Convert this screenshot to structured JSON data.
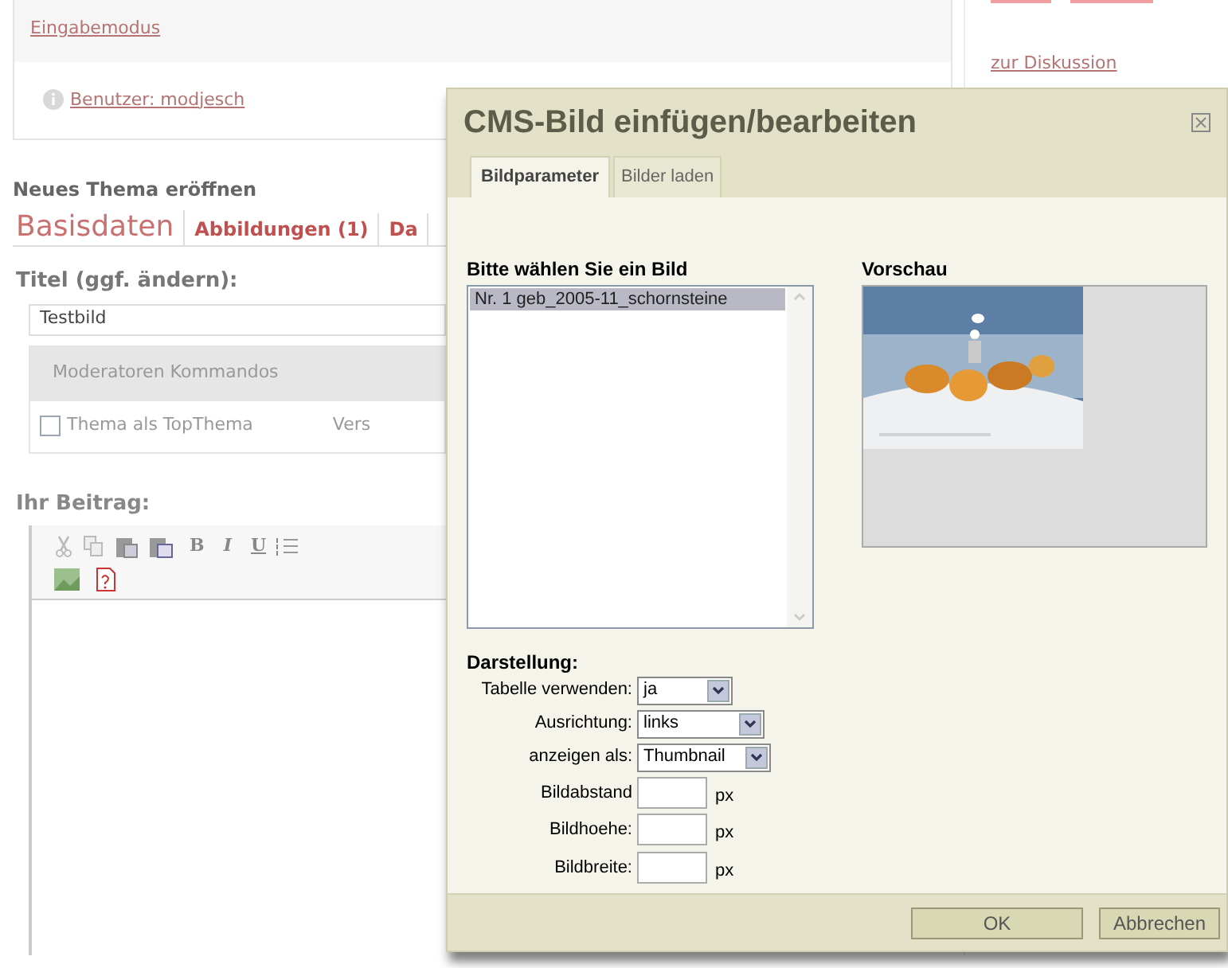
{
  "top_box": {
    "mode_link": "Eingabemodus",
    "user_link": "Benutzer: modjesch"
  },
  "sidebar": {
    "link": "zur Diskussion"
  },
  "form": {
    "heading": "Neues Thema eröffnen",
    "tabs": [
      {
        "label": "Basisdaten",
        "selected": true
      },
      {
        "label": "Abbildungen (1)",
        "selected": false
      },
      {
        "label": "Da",
        "selected": false
      }
    ],
    "title_label": "Titel (ggf. ändern):",
    "title_value": "Testbild",
    "moderator_heading": "Moderatoren Kommandos",
    "top_topic": {
      "label": "Thema als TopThema",
      "checked": false
    },
    "cut_text": "Vers",
    "post_label": "Ihr Beitrag:",
    "format_buttons": [
      "B",
      "I",
      "U"
    ]
  },
  "dialog": {
    "title": "CMS-Bild einfügen/bearbeiten",
    "tabs": [
      {
        "label": "Bildparameter",
        "selected": true
      },
      {
        "label": "Bilder laden",
        "selected": false
      }
    ],
    "list_label": "Bitte wählen Sie ein Bild",
    "images": [
      {
        "label": "Nr. 1 geb_2005-11_schornsteine",
        "selected": true
      }
    ],
    "preview_label": "Vorschau",
    "display_label": "Darstellung:",
    "fields": [
      {
        "kind": "select",
        "label": "Tabelle verwenden:",
        "value": "ja"
      },
      {
        "kind": "select",
        "label": "Ausrichtung:",
        "value": "links"
      },
      {
        "kind": "select",
        "label": "anzeigen als:",
        "value": "Thumbnail"
      },
      {
        "kind": "number",
        "label": "Bildabstand",
        "unit": "px"
      },
      {
        "kind": "number",
        "label": "Bildhoehe:",
        "unit": "px"
      },
      {
        "kind": "number",
        "label": "Bildbreite:",
        "unit": "px"
      }
    ],
    "buttons": [
      "OK",
      "Abbrechen"
    ]
  }
}
